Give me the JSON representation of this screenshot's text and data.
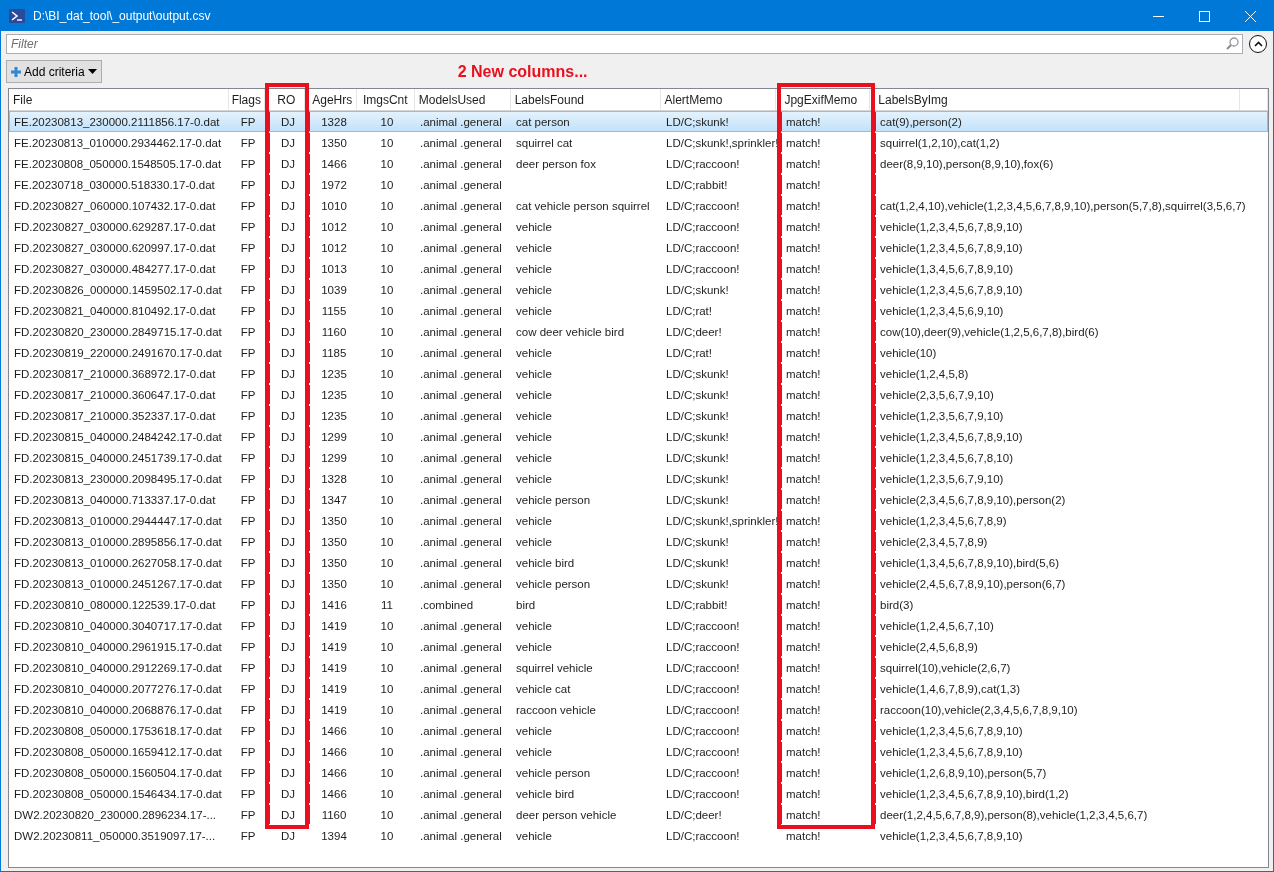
{
  "window": {
    "title": "D:\\BI_dat_tool\\_output\\output.csv"
  },
  "filter": {
    "placeholder": "Filter"
  },
  "add_criteria": {
    "label": "Add criteria"
  },
  "annotation": {
    "text": "2 New columns..."
  },
  "columns": [
    {
      "label": "File",
      "highlighted": false
    },
    {
      "label": "Flags",
      "highlighted": false
    },
    {
      "label": "RO",
      "highlighted": true
    },
    {
      "label": "AgeHrs",
      "highlighted": false
    },
    {
      "label": "ImgsCnt",
      "highlighted": false
    },
    {
      "label": "ModelsUsed",
      "highlighted": false
    },
    {
      "label": "LabelsFound",
      "highlighted": false
    },
    {
      "label": "AlertMemo",
      "highlighted": false
    },
    {
      "label": "JpgExifMemo",
      "highlighted": true
    },
    {
      "label": "LabelsByImg",
      "highlighted": false
    }
  ],
  "rows": [
    {
      "selected": true,
      "highlighted": true,
      "file": "FE.20230813_230000.2111856.17-0.dat",
      "flags": "FP",
      "ro": "DJ",
      "age_hrs": "1328",
      "imgs_cnt": "10",
      "models_used": ".animal .general",
      "labels_found": "cat person",
      "alert_memo": "LD/C;skunk!",
      "jpg_exif_memo": "match!",
      "labels_by_img": "cat(9),person(2)"
    },
    {
      "selected": false,
      "highlighted": true,
      "file": "FE.20230813_010000.2934462.17-0.dat",
      "flags": "FP",
      "ro": "DJ",
      "age_hrs": "1350",
      "imgs_cnt": "10",
      "models_used": ".animal .general",
      "labels_found": "squirrel cat",
      "alert_memo": "LD/C;skunk!,sprinkler!",
      "jpg_exif_memo": "match!",
      "labels_by_img": "squirrel(1,2,10),cat(1,2)"
    },
    {
      "selected": false,
      "highlighted": true,
      "file": "FE.20230808_050000.1548505.17-0.dat",
      "flags": "FP",
      "ro": "DJ",
      "age_hrs": "1466",
      "imgs_cnt": "10",
      "models_used": ".animal .general",
      "labels_found": "deer person fox",
      "alert_memo": "LD/C;raccoon!",
      "jpg_exif_memo": "match!",
      "labels_by_img": "deer(8,9,10),person(8,9,10),fox(6)"
    },
    {
      "selected": false,
      "highlighted": true,
      "file": "FE.20230718_030000.518330.17-0.dat",
      "flags": "FP",
      "ro": "DJ",
      "age_hrs": "1972",
      "imgs_cnt": "10",
      "models_used": ".animal .general",
      "alert_memo": "LD/C;rabbit!",
      "jpg_exif_memo": "match!"
    },
    {
      "selected": false,
      "highlighted": true,
      "file": "FD.20230827_060000.107432.17-0.dat",
      "flags": "FP",
      "ro": "DJ",
      "age_hrs": "1010",
      "imgs_cnt": "10",
      "models_used": ".animal .general",
      "labels_found": "cat vehicle person squirrel",
      "alert_memo": "LD/C;raccoon!",
      "jpg_exif_memo": "match!",
      "labels_by_img": "cat(1,2,4,10),vehicle(1,2,3,4,5,6,7,8,9,10),person(5,7,8),squirrel(3,5,6,7)"
    },
    {
      "selected": false,
      "highlighted": true,
      "file": "FD.20230827_030000.629287.17-0.dat",
      "flags": "FP",
      "ro": "DJ",
      "age_hrs": "1012",
      "imgs_cnt": "10",
      "models_used": ".animal .general",
      "labels_found": "vehicle",
      "alert_memo": "LD/C;raccoon!",
      "jpg_exif_memo": "match!",
      "labels_by_img": "vehicle(1,2,3,4,5,6,7,8,9,10)"
    },
    {
      "selected": false,
      "highlighted": true,
      "file": "FD.20230827_030000.620997.17-0.dat",
      "flags": "FP",
      "ro": "DJ",
      "age_hrs": "1012",
      "imgs_cnt": "10",
      "models_used": ".animal .general",
      "labels_found": "vehicle",
      "alert_memo": "LD/C;raccoon!",
      "jpg_exif_memo": "match!",
      "labels_by_img": "vehicle(1,2,3,4,5,6,7,8,9,10)"
    },
    {
      "selected": false,
      "highlighted": true,
      "file": "FD.20230827_030000.484277.17-0.dat",
      "flags": "FP",
      "ro": "DJ",
      "age_hrs": "1013",
      "imgs_cnt": "10",
      "models_used": ".animal .general",
      "labels_found": "vehicle",
      "alert_memo": "LD/C;raccoon!",
      "jpg_exif_memo": "match!",
      "labels_by_img": "vehicle(1,3,4,5,6,7,8,9,10)"
    },
    {
      "selected": false,
      "highlighted": true,
      "file": "FD.20230826_000000.1459502.17-0.dat",
      "flags": "FP",
      "ro": "DJ",
      "age_hrs": "1039",
      "imgs_cnt": "10",
      "models_used": ".animal .general",
      "labels_found": "vehicle",
      "alert_memo": "LD/C;skunk!",
      "jpg_exif_memo": "match!",
      "labels_by_img": "vehicle(1,2,3,4,5,6,7,8,9,10)"
    },
    {
      "selected": false,
      "highlighted": true,
      "file": "FD.20230821_040000.810492.17-0.dat",
      "flags": "FP",
      "ro": "DJ",
      "age_hrs": "1155",
      "imgs_cnt": "10",
      "models_used": ".animal .general",
      "labels_found": "vehicle",
      "alert_memo": "LD/C;rat!",
      "jpg_exif_memo": "match!",
      "labels_by_img": "vehicle(1,2,3,4,5,6,9,10)"
    },
    {
      "selected": false,
      "highlighted": true,
      "file": "FD.20230820_230000.2849715.17-0.dat",
      "flags": "FP",
      "ro": "DJ",
      "age_hrs": "1160",
      "imgs_cnt": "10",
      "models_used": ".animal .general",
      "labels_found": "cow deer vehicle bird",
      "alert_memo": "LD/C;deer!",
      "jpg_exif_memo": "match!",
      "labels_by_img": "cow(10),deer(9),vehicle(1,2,5,6,7,8),bird(6)"
    },
    {
      "selected": false,
      "highlighted": true,
      "file": "FD.20230819_220000.2491670.17-0.dat",
      "flags": "FP",
      "ro": "DJ",
      "age_hrs": "1185",
      "imgs_cnt": "10",
      "models_used": ".animal .general",
      "labels_found": "vehicle",
      "alert_memo": "LD/C;rat!",
      "jpg_exif_memo": "match!",
      "labels_by_img": "vehicle(10)"
    },
    {
      "selected": false,
      "highlighted": true,
      "file": "FD.20230817_210000.368972.17-0.dat",
      "flags": "FP",
      "ro": "DJ",
      "age_hrs": "1235",
      "imgs_cnt": "10",
      "models_used": ".animal .general",
      "labels_found": "vehicle",
      "alert_memo": "LD/C;skunk!",
      "jpg_exif_memo": "match!",
      "labels_by_img": "vehicle(1,2,4,5,8)"
    },
    {
      "selected": false,
      "highlighted": true,
      "file": "FD.20230817_210000.360647.17-0.dat",
      "flags": "FP",
      "ro": "DJ",
      "age_hrs": "1235",
      "imgs_cnt": "10",
      "models_used": ".animal .general",
      "labels_found": "vehicle",
      "alert_memo": "LD/C;skunk!",
      "jpg_exif_memo": "match!",
      "labels_by_img": "vehicle(2,3,5,6,7,9,10)"
    },
    {
      "selected": false,
      "highlighted": true,
      "file": "FD.20230817_210000.352337.17-0.dat",
      "flags": "FP",
      "ro": "DJ",
      "age_hrs": "1235",
      "imgs_cnt": "10",
      "models_used": ".animal .general",
      "labels_found": "vehicle",
      "alert_memo": "LD/C;skunk!",
      "jpg_exif_memo": "match!",
      "labels_by_img": "vehicle(1,2,3,5,6,7,9,10)"
    },
    {
      "selected": false,
      "highlighted": true,
      "file": "FD.20230815_040000.2484242.17-0.dat",
      "flags": "FP",
      "ro": "DJ",
      "age_hrs": "1299",
      "imgs_cnt": "10",
      "models_used": ".animal .general",
      "labels_found": "vehicle",
      "alert_memo": "LD/C;skunk!",
      "jpg_exif_memo": "match!",
      "labels_by_img": "vehicle(1,2,3,4,5,6,7,8,9,10)"
    },
    {
      "selected": false,
      "highlighted": true,
      "file": "FD.20230815_040000.2451739.17-0.dat",
      "flags": "FP",
      "ro": "DJ",
      "age_hrs": "1299",
      "imgs_cnt": "10",
      "models_used": ".animal .general",
      "labels_found": "vehicle",
      "alert_memo": "LD/C;skunk!",
      "jpg_exif_memo": "match!",
      "labels_by_img": "vehicle(1,2,3,4,5,6,7,8,10)"
    },
    {
      "selected": false,
      "highlighted": true,
      "file": "FD.20230813_230000.2098495.17-0.dat",
      "flags": "FP",
      "ro": "DJ",
      "age_hrs": "1328",
      "imgs_cnt": "10",
      "models_used": ".animal .general",
      "labels_found": "vehicle",
      "alert_memo": "LD/C;skunk!",
      "jpg_exif_memo": "match!",
      "labels_by_img": "vehicle(1,2,3,5,6,7,9,10)"
    },
    {
      "selected": false,
      "highlighted": true,
      "file": "FD.20230813_040000.713337.17-0.dat",
      "flags": "FP",
      "ro": "DJ",
      "age_hrs": "1347",
      "imgs_cnt": "10",
      "models_used": ".animal .general",
      "labels_found": "vehicle person",
      "alert_memo": "LD/C;skunk!",
      "jpg_exif_memo": "match!",
      "labels_by_img": "vehicle(2,3,4,5,6,7,8,9,10),person(2)"
    },
    {
      "selected": false,
      "highlighted": true,
      "file": "FD.20230813_010000.2944447.17-0.dat",
      "flags": "FP",
      "ro": "DJ",
      "age_hrs": "1350",
      "imgs_cnt": "10",
      "models_used": ".animal .general",
      "labels_found": "vehicle",
      "alert_memo": "LD/C;skunk!,sprinkler!",
      "jpg_exif_memo": "match!",
      "labels_by_img": "vehicle(1,2,3,4,5,6,7,8,9)"
    },
    {
      "selected": false,
      "highlighted": true,
      "file": "FD.20230813_010000.2895856.17-0.dat",
      "flags": "FP",
      "ro": "DJ",
      "age_hrs": "1350",
      "imgs_cnt": "10",
      "models_used": ".animal .general",
      "labels_found": "vehicle",
      "alert_memo": "LD/C;skunk!",
      "jpg_exif_memo": "match!",
      "labels_by_img": "vehicle(2,3,4,5,7,8,9)"
    },
    {
      "selected": false,
      "highlighted": true,
      "file": "FD.20230813_010000.2627058.17-0.dat",
      "flags": "FP",
      "ro": "DJ",
      "age_hrs": "1350",
      "imgs_cnt": "10",
      "models_used": ".animal .general",
      "labels_found": "vehicle bird",
      "alert_memo": "LD/C;skunk!",
      "jpg_exif_memo": "match!",
      "labels_by_img": "vehicle(1,3,4,5,6,7,8,9,10),bird(5,6)"
    },
    {
      "selected": false,
      "highlighted": true,
      "file": "FD.20230813_010000.2451267.17-0.dat",
      "flags": "FP",
      "ro": "DJ",
      "age_hrs": "1350",
      "imgs_cnt": "10",
      "models_used": ".animal .general",
      "labels_found": "vehicle person",
      "alert_memo": "LD/C;skunk!",
      "jpg_exif_memo": "match!",
      "labels_by_img": "vehicle(2,4,5,6,7,8,9,10),person(6,7)"
    },
    {
      "selected": false,
      "highlighted": true,
      "file": "FD.20230810_080000.122539.17-0.dat",
      "flags": "FP",
      "ro": "DJ",
      "age_hrs": "1416",
      "imgs_cnt": "11",
      "models_used": ".combined",
      "labels_found": "bird",
      "alert_memo": "LD/C;rabbit!",
      "jpg_exif_memo": "match!",
      "labels_by_img": "bird(3)"
    },
    {
      "selected": false,
      "highlighted": true,
      "file": "FD.20230810_040000.3040717.17-0.dat",
      "flags": "FP",
      "ro": "DJ",
      "age_hrs": "1419",
      "imgs_cnt": "10",
      "models_used": ".animal .general",
      "labels_found": "vehicle",
      "alert_memo": "LD/C;raccoon!",
      "jpg_exif_memo": "match!",
      "labels_by_img": "vehicle(1,2,4,5,6,7,10)"
    },
    {
      "selected": false,
      "highlighted": true,
      "file": "FD.20230810_040000.2961915.17-0.dat",
      "flags": "FP",
      "ro": "DJ",
      "age_hrs": "1419",
      "imgs_cnt": "10",
      "models_used": ".animal .general",
      "labels_found": "vehicle",
      "alert_memo": "LD/C;raccoon!",
      "jpg_exif_memo": "match!",
      "labels_by_img": "vehicle(2,4,5,6,8,9)"
    },
    {
      "selected": false,
      "highlighted": true,
      "file": "FD.20230810_040000.2912269.17-0.dat",
      "flags": "FP",
      "ro": "DJ",
      "age_hrs": "1419",
      "imgs_cnt": "10",
      "models_used": ".animal .general",
      "labels_found": "squirrel vehicle",
      "alert_memo": "LD/C;raccoon!",
      "jpg_exif_memo": "match!",
      "labels_by_img": "squirrel(10),vehicle(2,6,7)"
    },
    {
      "selected": false,
      "highlighted": true,
      "file": "FD.20230810_040000.2077276.17-0.dat",
      "flags": "FP",
      "ro": "DJ",
      "age_hrs": "1419",
      "imgs_cnt": "10",
      "models_used": ".animal .general",
      "labels_found": "vehicle cat",
      "alert_memo": "LD/C;raccoon!",
      "jpg_exif_memo": "match!",
      "labels_by_img": "vehicle(1,4,6,7,8,9),cat(1,3)"
    },
    {
      "selected": false,
      "highlighted": true,
      "file": "FD.20230810_040000.2068876.17-0.dat",
      "flags": "FP",
      "ro": "DJ",
      "age_hrs": "1419",
      "imgs_cnt": "10",
      "models_used": ".animal .general",
      "labels_found": "raccoon vehicle",
      "alert_memo": "LD/C;raccoon!",
      "jpg_exif_memo": "match!",
      "labels_by_img": "raccoon(10),vehicle(2,3,4,5,6,7,8,9,10)"
    },
    {
      "selected": false,
      "highlighted": true,
      "file": "FD.20230808_050000.1753618.17-0.dat",
      "flags": "FP",
      "ro": "DJ",
      "age_hrs": "1466",
      "imgs_cnt": "10",
      "models_used": ".animal .general",
      "labels_found": "vehicle",
      "alert_memo": "LD/C;raccoon!",
      "jpg_exif_memo": "match!",
      "labels_by_img": "vehicle(1,2,3,4,5,6,7,8,9,10)"
    },
    {
      "selected": false,
      "highlighted": true,
      "file": "FD.20230808_050000.1659412.17-0.dat",
      "flags": "FP",
      "ro": "DJ",
      "age_hrs": "1466",
      "imgs_cnt": "10",
      "models_used": ".animal .general",
      "labels_found": "vehicle",
      "alert_memo": "LD/C;raccoon!",
      "jpg_exif_memo": "match!",
      "labels_by_img": "vehicle(1,2,3,4,5,6,7,8,9,10)"
    },
    {
      "selected": false,
      "highlighted": true,
      "file": "FD.20230808_050000.1560504.17-0.dat",
      "flags": "FP",
      "ro": "DJ",
      "age_hrs": "1466",
      "imgs_cnt": "10",
      "models_used": ".animal .general",
      "labels_found": "vehicle person",
      "alert_memo": "LD/C;raccoon!",
      "jpg_exif_memo": "match!",
      "labels_by_img": "vehicle(1,2,6,8,9,10),person(5,7)"
    },
    {
      "selected": false,
      "highlighted": true,
      "file": "FD.20230808_050000.1546434.17-0.dat",
      "flags": "FP",
      "ro": "DJ",
      "age_hrs": "1466",
      "imgs_cnt": "10",
      "models_used": ".animal .general",
      "labels_found": "vehicle bird",
      "alert_memo": "LD/C;raccoon!",
      "jpg_exif_memo": "match!",
      "labels_by_img": "vehicle(1,2,3,4,5,6,7,8,9,10),bird(1,2)"
    },
    {
      "selected": false,
      "highlighted": true,
      "file": "DW2.20230820_230000.2896234.17-...",
      "flags": "FP",
      "ro": "DJ",
      "age_hrs": "1160",
      "imgs_cnt": "10",
      "models_used": ".animal .general",
      "labels_found": "deer person vehicle",
      "alert_memo": "LD/C;deer!",
      "jpg_exif_memo": "match!",
      "labels_by_img": "deer(1,2,4,5,6,7,8,9),person(8),vehicle(1,2,3,4,5,6,7)"
    },
    {
      "selected": false,
      "highlighted": false,
      "file": "DW2.20230811_050000.3519097.17-...",
      "flags": "FP",
      "ro": "DJ",
      "age_hrs": "1394",
      "imgs_cnt": "10",
      "models_used": ".animal .general",
      "labels_found": "vehicle",
      "alert_memo": "LD/C;raccoon!",
      "jpg_exif_memo": "match!",
      "labels_by_img": "vehicle(1,2,3,4,5,6,7,8,9,10)"
    }
  ]
}
